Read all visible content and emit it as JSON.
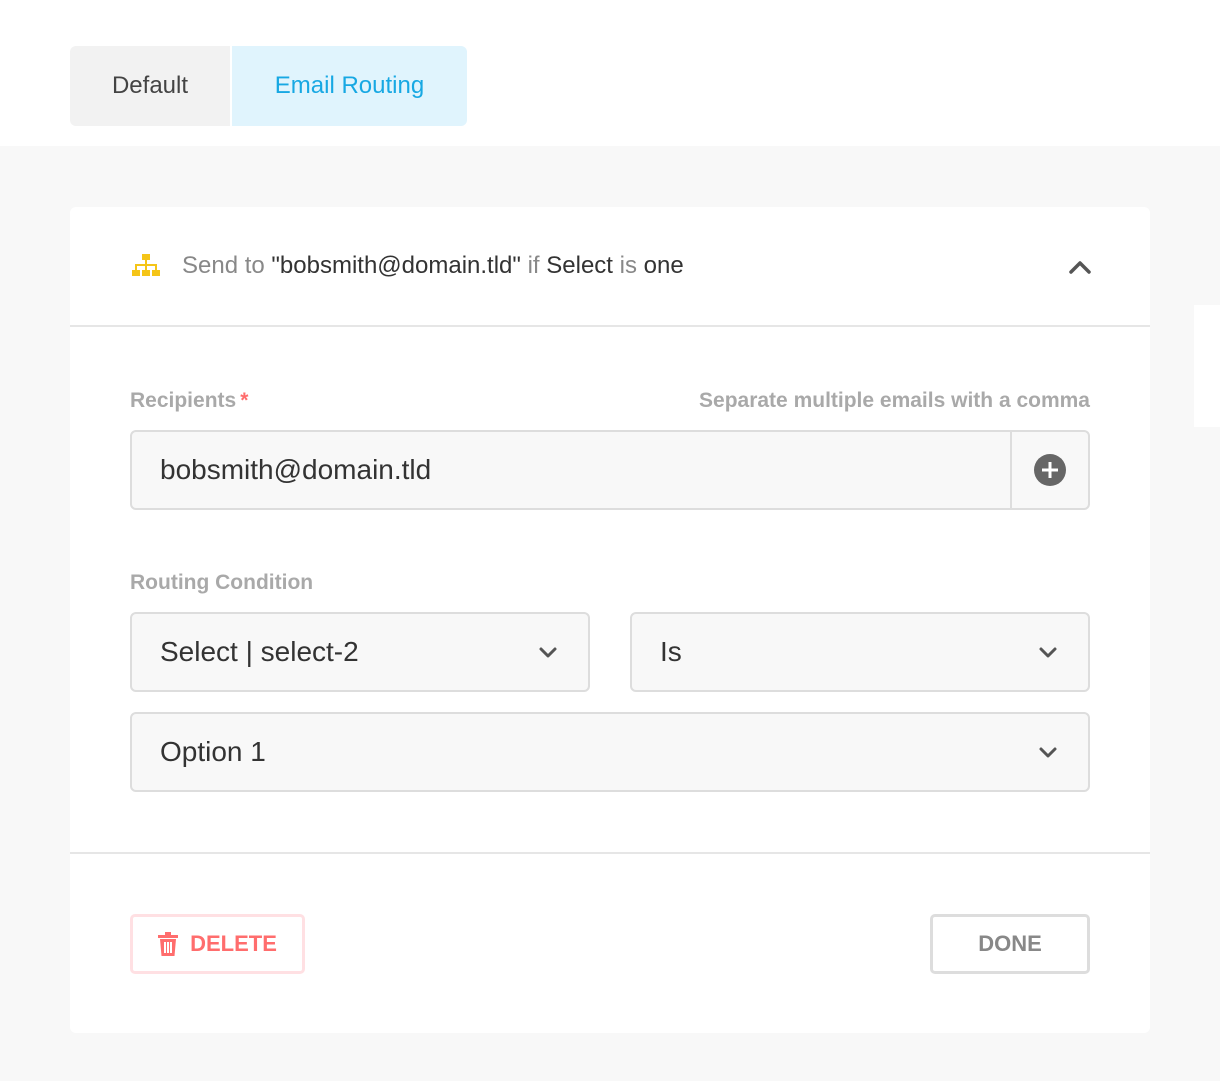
{
  "tabs": [
    {
      "label": "Default",
      "active": false
    },
    {
      "label": "Email Routing",
      "active": true
    }
  ],
  "route": {
    "summary": {
      "prefix": "Send to ",
      "recipient_quoted": "\"bobsmith@domain.tld\"",
      "if_word": " if ",
      "field": "Select",
      "is_word": " is ",
      "value": "one"
    },
    "collapse_icon": "chevron-up-icon",
    "routing_icon": "sitemap-icon"
  },
  "recipients": {
    "label": "Recipients",
    "required_mark": "*",
    "help": "Separate multiple emails with a comma",
    "value": "bobsmith@domain.tld",
    "add_icon": "plus-circle-icon"
  },
  "condition": {
    "label": "Routing Condition",
    "field_selected": "Select | select-2",
    "operator_selected": "Is",
    "value_selected": "Option 1"
  },
  "actions": {
    "delete_label": "DELETE",
    "done_label": "DONE"
  },
  "colors": {
    "accent": "#17a8e3",
    "tab_active_bg": "#e0f4fd",
    "danger": "#ff6d6d",
    "icon_yellow": "#f5c518"
  }
}
